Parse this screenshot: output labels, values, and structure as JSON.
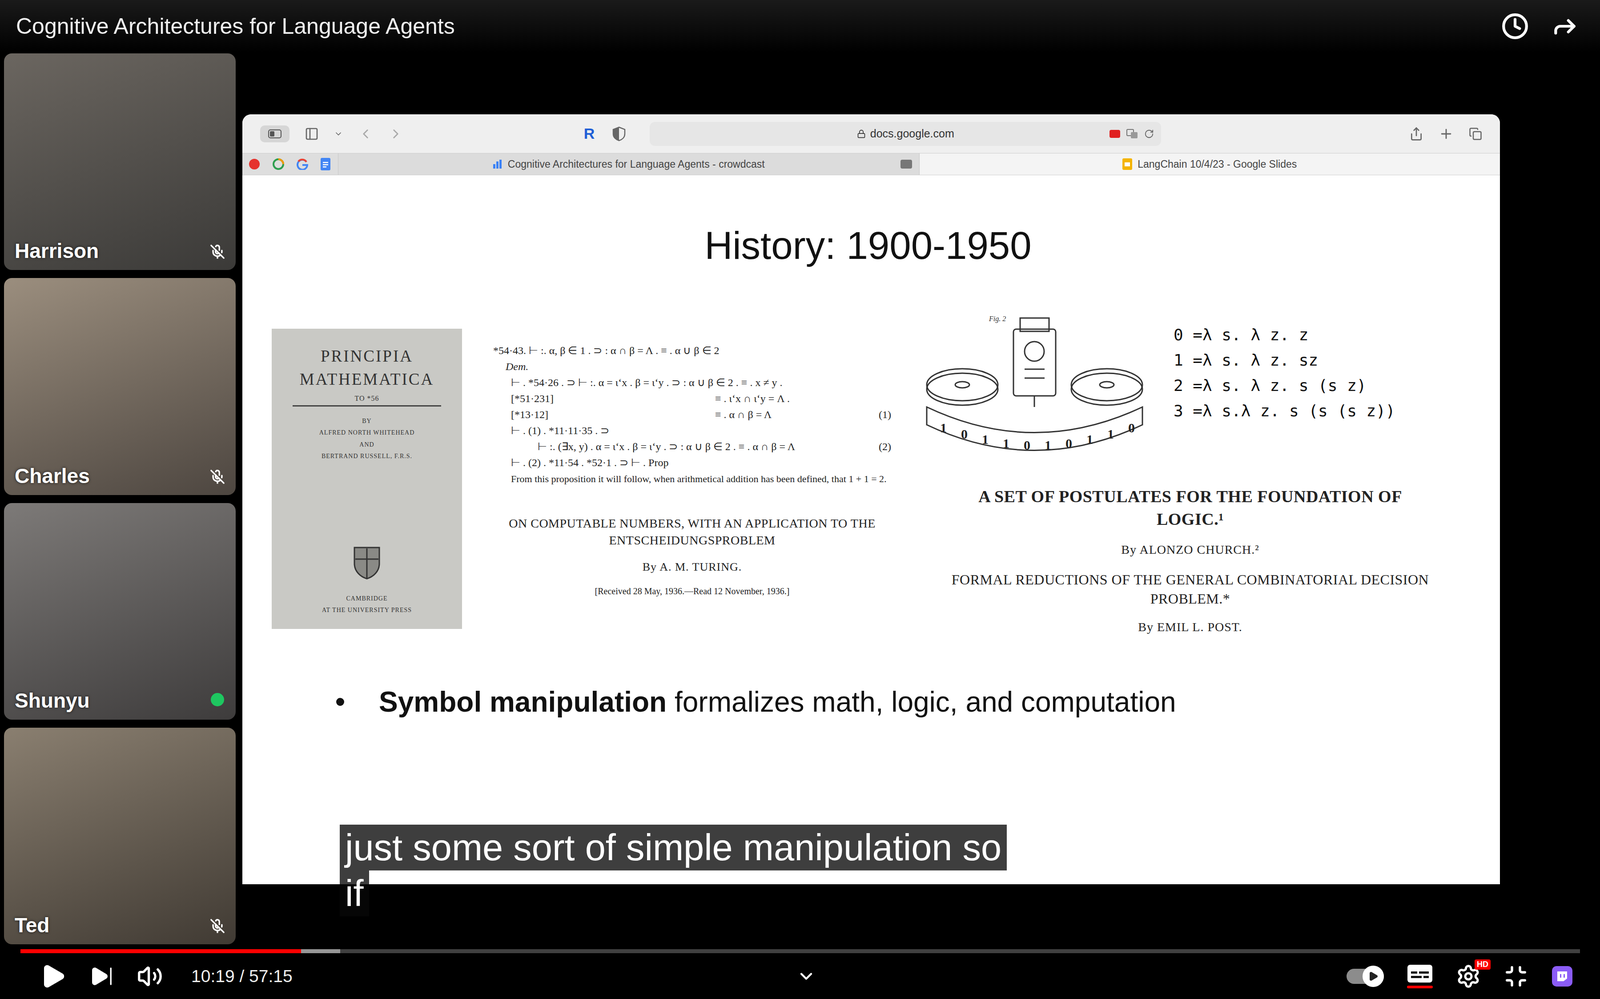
{
  "window": {
    "title": "Cognitive Architectures for Language Agents"
  },
  "participants": [
    {
      "name": "Harrison",
      "muted": true,
      "speaking": false
    },
    {
      "name": "Charles",
      "muted": true,
      "speaking": false
    },
    {
      "name": "Shunyu",
      "muted": false,
      "speaking": true
    },
    {
      "name": "Ted",
      "muted": true,
      "speaking": false
    }
  ],
  "browser": {
    "extension_label": "R",
    "url": "docs.google.com",
    "tabs": [
      {
        "label": "Cognitive Architectures for Language Agents - crowdcast",
        "selected": false
      },
      {
        "label": "LangChain 10/4/23 - Google Slides",
        "selected": true
      }
    ]
  },
  "slide": {
    "title": "History: 1900-1950",
    "book": {
      "title_lines": [
        "PRINCIPIA",
        "MATHEMATICA"
      ],
      "subtitle": "TO *56",
      "authors": [
        "BY",
        "ALFRED NORTH WHITEHEAD",
        "AND",
        "BERTRAND RUSSELL, F.R.S."
      ],
      "publisher": [
        "CAMBRIDGE",
        "AT THE UNIVERSITY PRESS"
      ]
    },
    "proof": {
      "lines": [
        {
          "kind": "head",
          "text": "*54·43. ⊢ :. α, β ∈ 1 . ⊃ : α ∩ β = Λ . ≡ . α ∪ β ∈ 2",
          "right": "",
          "tag": ""
        },
        {
          "kind": "step",
          "text": "Dem.",
          "right": "",
          "tag": ""
        },
        {
          "kind": "sub",
          "text": "⊢ . *54·26 . ⊃ ⊢ :. α = ι‘x . β = ι‘y . ⊃ : α ∪ β ∈ 2 . ≡ . x ≠ y .",
          "right": "",
          "tag": ""
        },
        {
          "kind": "sub",
          "text": "[*51·231]",
          "right": "≡ . ι‘x ∩ ι‘y = Λ .",
          "tag": ""
        },
        {
          "kind": "sub",
          "text": "[*13·12]",
          "right": "≡ . α ∩ β = Λ",
          "tag": "(1)"
        },
        {
          "kind": "sub",
          "text": "⊢ . (1) . *11·11·35 . ⊃",
          "right": "",
          "tag": ""
        },
        {
          "kind": "deep",
          "text": "⊢ :. (∃x, y) . α = ι‘x . β = ι‘y . ⊃ : α ∪ β ∈ 2 . ≡ . α ∩ β = Λ",
          "right": "",
          "tag": "(2)"
        },
        {
          "kind": "sub",
          "text": "⊢ . (2) . *11·54 . *52·1 . ⊃ ⊢ . Prop",
          "right": "",
          "tag": ""
        }
      ],
      "note": "From this proposition it will follow, when arithmetical addition has been defined, that 1 + 1 = 2."
    },
    "turing": {
      "title": "ON COMPUTABLE NUMBERS, WITH AN APPLICATION TO THE ENTSCHEIDUNGSPROBLEM",
      "author": "By A. M. TURING.",
      "note": "[Received 28 May, 1936.—Read 12 November, 1936.]"
    },
    "machine": {
      "figure_label": "Fig. 2",
      "tape": [
        "1",
        "0",
        "1",
        "1",
        "0",
        "1",
        "0",
        "1",
        "1",
        "0"
      ]
    },
    "lambda": [
      "0 =λ s. λ z. z",
      "1 =λ s. λ z. sz",
      "2 =λ s. λ z. s (s z)",
      "3 =λ s.λ z. s (s (s z))"
    ],
    "papers": [
      {
        "title": "A SET OF POSTULATES FOR THE FOUNDATION OF LOGIC.¹",
        "author": "By ALONZO CHURCH.²",
        "kind": "bold"
      },
      {
        "title": "FORMAL REDUCTIONS OF THE GENERAL COMBINATORIAL DECISION PROBLEM.*",
        "author": "By EMIL L. POST.",
        "kind": "plain"
      }
    ],
    "bullet": {
      "bold": "Symbol manipulation",
      "rest": " formalizes math, logic, and computation"
    }
  },
  "caption": {
    "lines": [
      "just some sort of simple manipulation so",
      "if"
    ]
  },
  "player": {
    "progress": 0.18,
    "buffered": 0.205,
    "time": "10:19 / 57:15",
    "autoplay": true,
    "captions": true,
    "quality_badge": "HD"
  }
}
